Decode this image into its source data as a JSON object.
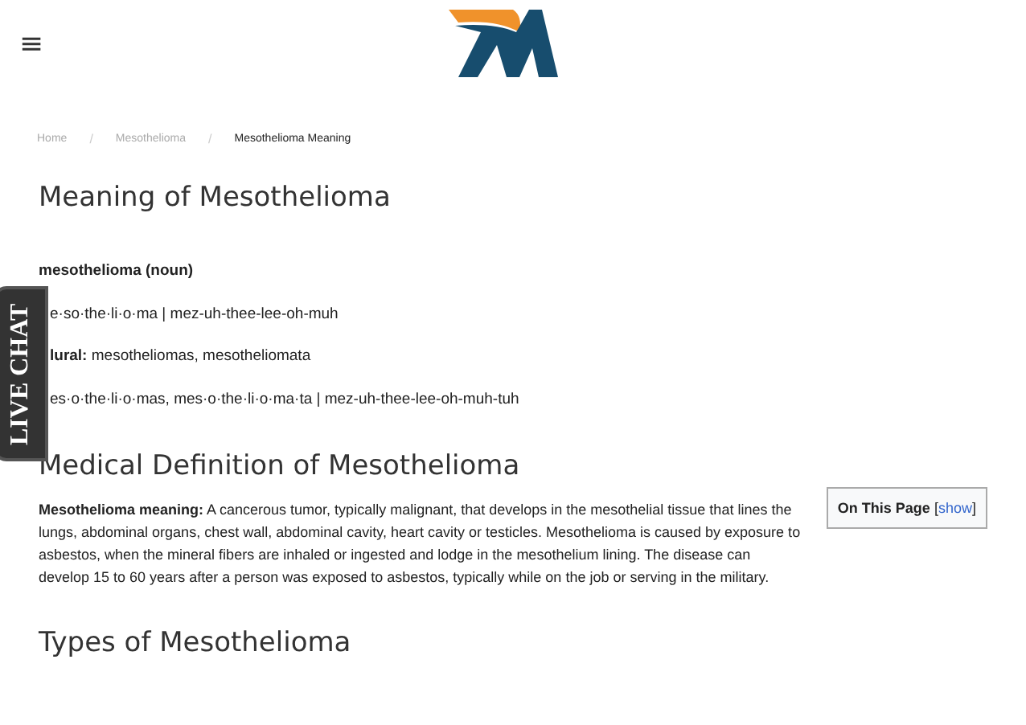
{
  "header": {
    "menu": "≡"
  },
  "breadcrumbs": [
    {
      "label": "Home",
      "selected": false
    },
    {
      "label": "Mesothelioma",
      "selected": false
    },
    {
      "label": "Mesothelioma Meaning",
      "selected": true
    }
  ],
  "breadcrumb_separator": "/",
  "live_chat": "LIVE CHAT",
  "title": "Meaning of Mesothelioma",
  "definition_lines": [
    {
      "kind": "term",
      "text": "mesothelioma (noun)"
    },
    {
      "kind": "covered",
      "text": "e·so·the·li·o·ma | mez-uh-thee-lee-oh-muh"
    },
    {
      "kind": "covered",
      "text": "**lural:** mesotheliomas, mesotheliomata"
    },
    {
      "kind": "covered",
      "text": "es·o·the·li·o·mas, mes·o·the·li·o·ma·ta | mez-uh-thee-lee-oh-muh-tuh"
    }
  ],
  "section_title": "Medical Definition of Mesothelioma",
  "toc": {
    "label": "On This Page",
    "open": "[",
    "link": "show",
    "close": "]"
  },
  "paragraph": "**Mesothelioma meaning:** A cancerous tumor, typically malignant, that develops in the mesothelial tissue that lines the lungs, abdominal organs, chest wall, abdominal cavity, heart cavity or testicles. Mesothelioma is caused by exposure to asbestos, when the mineral fibers are inhaled or ingested and lodge in the mesothelium lining. The disease can develop 15 to 60 years after a person was exposed to asbestos, typically while on the job or serving in the military.",
  "next_section_title": "Types of Mesothelioma"
}
